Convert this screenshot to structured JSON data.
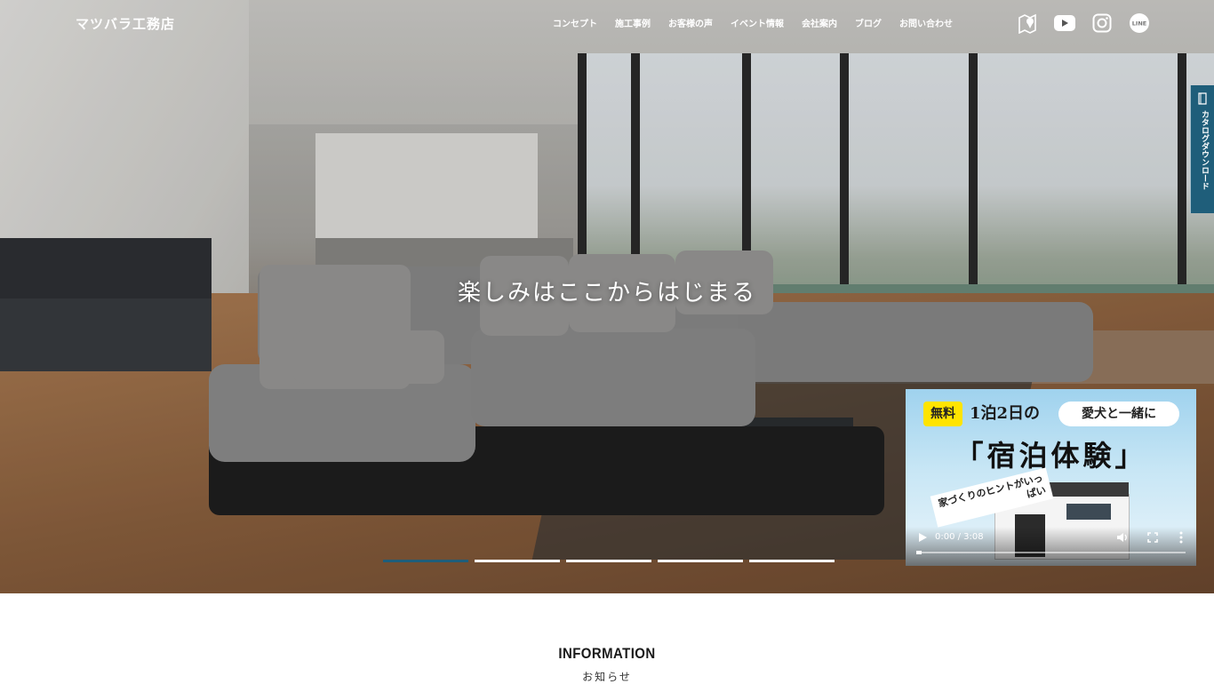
{
  "header": {
    "logo": "マツバラ工務店",
    "nav": [
      "コンセプト",
      "施工事例",
      "お客様の声",
      "イベント情報",
      "会社案内",
      "ブログ",
      "お問い合わせ"
    ],
    "social_icons": [
      "map-pin-icon",
      "youtube-icon",
      "instagram-icon",
      "line-icon"
    ],
    "line_label": "LINE"
  },
  "catalog_tab": {
    "label": "カタログダウンロード",
    "icon": "book-icon"
  },
  "hero": {
    "title": "楽しみはここからはじまる",
    "slide_count": 5,
    "active_slide": 1
  },
  "video": {
    "badge": "無料",
    "stay": "1泊2日の",
    "pill": "愛犬と一緒に",
    "headline": "「宿泊体験」",
    "hint": "家づくりのヒントがいっぱい",
    "time": "0:00 / 3:08",
    "progress": 0
  },
  "info": {
    "title": "INFORMATION",
    "subtitle": "お知らせ"
  },
  "colors": {
    "accent": "#1f5e7a",
    "badge": "#ffe400"
  }
}
